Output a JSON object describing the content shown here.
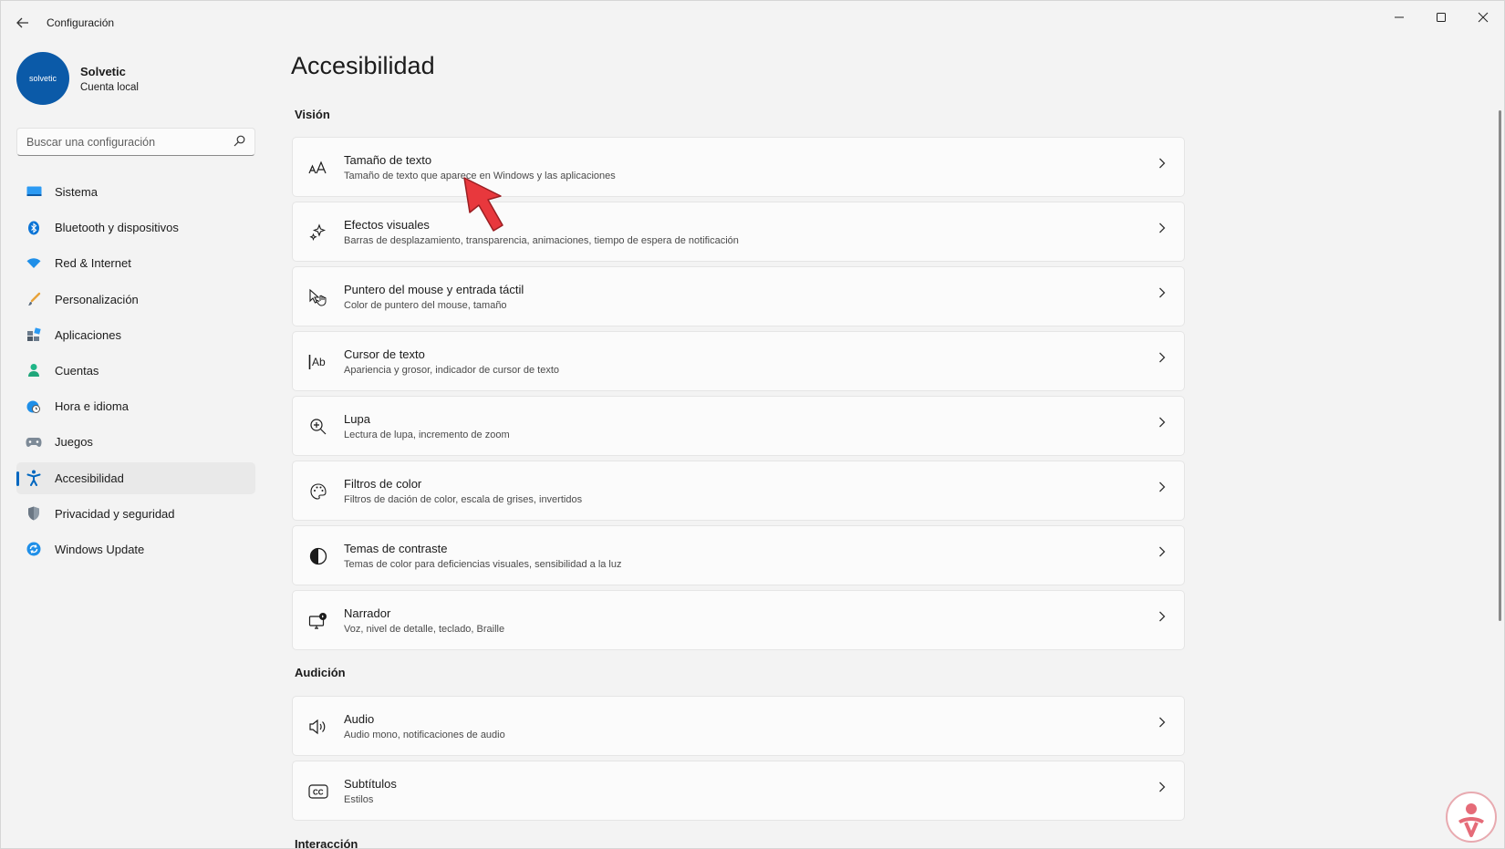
{
  "window": {
    "title": "Configuración"
  },
  "profile": {
    "avatar_text": "solvetic",
    "name": "Solvetic",
    "account_type": "Cuenta local"
  },
  "search": {
    "placeholder": "Buscar una configuración"
  },
  "sidebar": {
    "items": [
      {
        "label": "Sistema",
        "icon": "monitor-icon",
        "color": "#0078d4"
      },
      {
        "label": "Bluetooth y dispositivos",
        "icon": "bluetooth-icon",
        "color": "#0078d4"
      },
      {
        "label": "Red & Internet",
        "icon": "wifi-icon",
        "color": "#0078d4"
      },
      {
        "label": "Personalización",
        "icon": "brush-icon",
        "color": "#e08a1e"
      },
      {
        "label": "Aplicaciones",
        "icon": "apps-icon",
        "color": "#555555"
      },
      {
        "label": "Cuentas",
        "icon": "person-icon",
        "color": "#1fa67a"
      },
      {
        "label": "Hora e idioma",
        "icon": "globe-clock-icon",
        "color": "#0078d4"
      },
      {
        "label": "Juegos",
        "icon": "gamepad-icon",
        "color": "#6b6b6b"
      },
      {
        "label": "Accesibilidad",
        "icon": "accessibility-icon",
        "color": "#0067c0",
        "active": true
      },
      {
        "label": "Privacidad y seguridad",
        "icon": "shield-icon",
        "color": "#7a7a7a"
      },
      {
        "label": "Windows Update",
        "icon": "sync-icon",
        "color": "#0078d4"
      }
    ]
  },
  "main": {
    "title": "Accesibilidad",
    "sections": [
      {
        "title": "Visión",
        "cards": [
          {
            "title": "Tamaño de texto",
            "desc": "Tamaño de texto que aparece en Windows y las aplicaciones",
            "icon": "text-size-icon"
          },
          {
            "title": "Efectos visuales",
            "desc": "Barras de desplazamiento, transparencia, animaciones, tiempo de espera de notificación",
            "icon": "sparkle-icon"
          },
          {
            "title": "Puntero del mouse y entrada táctil",
            "desc": "Color de puntero del mouse, tamaño",
            "icon": "pointer-touch-icon"
          },
          {
            "title": "Cursor de texto",
            "desc": "Apariencia y grosor, indicador de cursor de texto",
            "icon": "text-cursor-icon"
          },
          {
            "title": "Lupa",
            "desc": "Lectura de lupa, incremento de zoom",
            "icon": "magnifier-icon"
          },
          {
            "title": "Filtros de color",
            "desc": "Filtros de dación de color, escala de grises, invertidos",
            "icon": "palette-icon"
          },
          {
            "title": "Temas de contraste",
            "desc": "Temas de color para deficiencias visuales, sensibilidad a la luz",
            "icon": "contrast-icon"
          },
          {
            "title": "Narrador",
            "desc": "Voz, nivel de detalle, teclado, Braille",
            "icon": "narrator-icon"
          }
        ]
      },
      {
        "title": "Audición",
        "cards": [
          {
            "title": "Audio",
            "desc": "Audio mono, notificaciones de audio",
            "icon": "speaker-icon"
          },
          {
            "title": "Subtítulos",
            "desc": "Estilos",
            "icon": "captions-icon"
          }
        ]
      },
      {
        "title": "Interacción",
        "cards": []
      }
    ]
  },
  "colors": {
    "accent": "#0067c0",
    "annotation_arrow": "#e8383d"
  }
}
